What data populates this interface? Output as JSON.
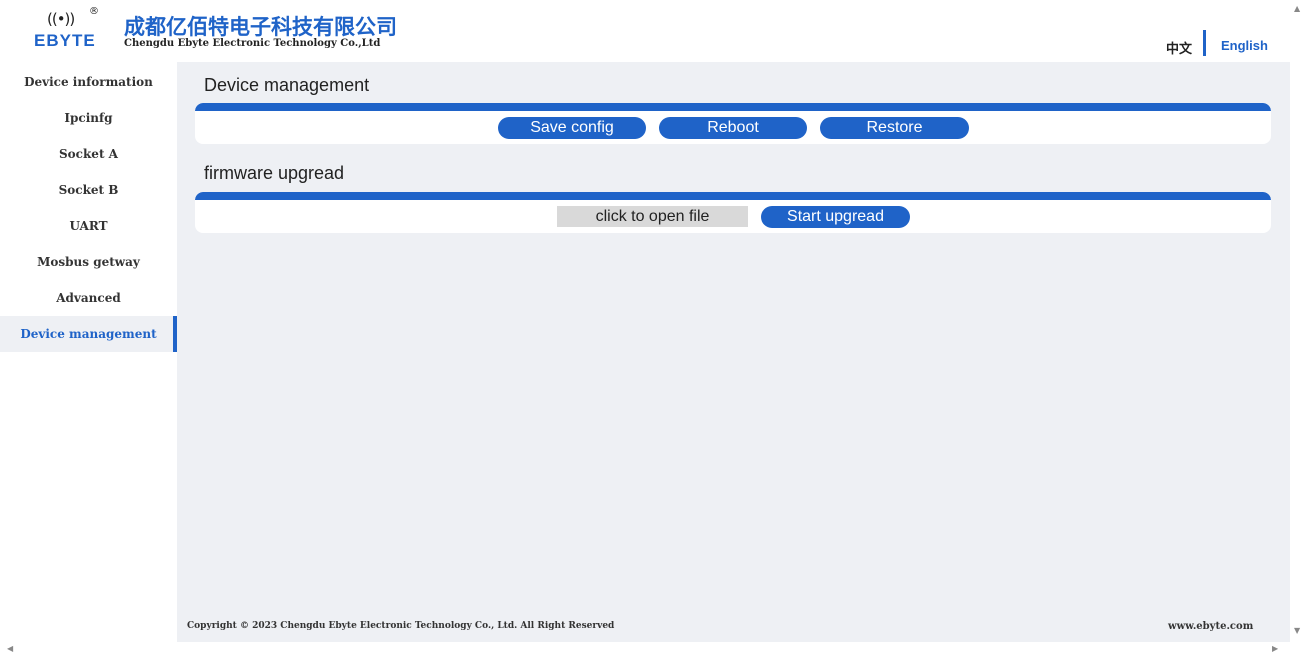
{
  "header": {
    "logo_text": "EBYTE",
    "logo_waves": "((•))",
    "logo_registered": "®",
    "company_cn": "成都亿佰特电子科技有限公司",
    "company_en": "Chengdu Ebyte Electronic Technology Co.,Ltd",
    "lang_cn": "中文",
    "lang_en": "English"
  },
  "sidebar": {
    "items": [
      {
        "label": "Device information"
      },
      {
        "label": "Ipcinfg"
      },
      {
        "label": "Socket A"
      },
      {
        "label": "Socket B"
      },
      {
        "label": "UART"
      },
      {
        "label": "Mosbus getway"
      },
      {
        "label": "Advanced"
      },
      {
        "label": "Device management",
        "active": true
      }
    ]
  },
  "main": {
    "device_management": {
      "title": "Device management",
      "buttons": {
        "save": "Save config",
        "reboot": "Reboot",
        "restore": "Restore"
      }
    },
    "firmware": {
      "title": "firmware upgread",
      "open_file": "click to open file",
      "start": "Start upgread"
    }
  },
  "footer": {
    "copyright": "Copyright © 2023 Chengdu Ebyte Electronic Technology Co., Ltd. All Right Reserved",
    "website": "www.ebyte.com"
  },
  "colors": {
    "accent": "#1f63c8",
    "background": "#eef0f4"
  },
  "icons": {
    "scroll_up": "triangle-up-icon",
    "scroll_down": "triangle-down-icon",
    "scroll_left": "triangle-left-icon",
    "scroll_right": "triangle-right-icon"
  }
}
